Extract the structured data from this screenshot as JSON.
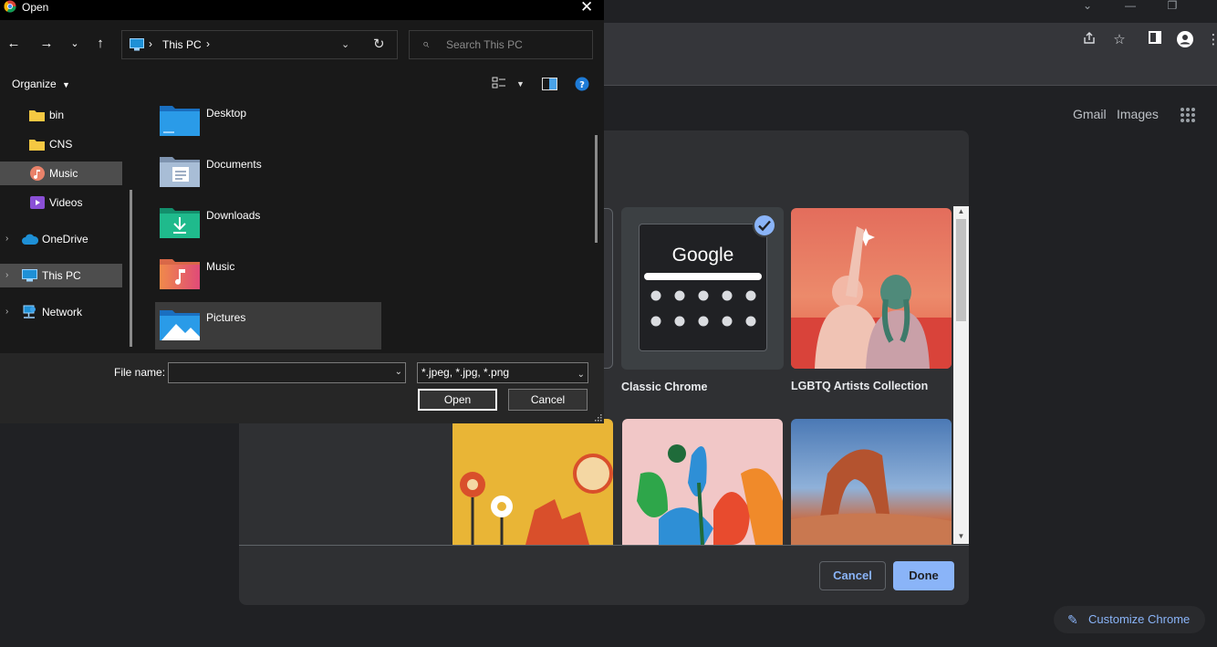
{
  "open_dialog": {
    "title": "Open",
    "breadcrumb": {
      "location": "This PC"
    },
    "search_placeholder": "Search This PC",
    "organize_label": "Organize",
    "nav_tree": [
      {
        "label": "bin"
      },
      {
        "label": "CNS"
      },
      {
        "label": "Music"
      },
      {
        "label": "Videos"
      },
      {
        "label": "OneDrive"
      },
      {
        "label": "This PC"
      },
      {
        "label": "Network"
      }
    ],
    "folders": [
      {
        "label": "Desktop"
      },
      {
        "label": "Documents"
      },
      {
        "label": "Downloads"
      },
      {
        "label": "Music"
      },
      {
        "label": "Pictures"
      }
    ],
    "file_name_label": "File name:",
    "file_name_value": "",
    "file_type_value": "*.jpeg, *.jpg, *.png",
    "open_label": "Open",
    "cancel_label": "Cancel"
  },
  "chrome": {
    "links": {
      "gmail": "Gmail",
      "images": "Images"
    },
    "customize_chrome_label": "Customize Chrome"
  },
  "customize_dialog": {
    "tiles": [
      {
        "caption": "Classic Chrome",
        "logo_text": "Google"
      },
      {
        "caption": "LGBTQ Artists Collection"
      }
    ],
    "cancel_label": "Cancel",
    "done_label": "Done"
  },
  "colors": {
    "accent": "#8ab4f8",
    "dialog_bg": "#2f3033",
    "explorer_bg": "#191919",
    "selection": "#4d4d4d"
  }
}
